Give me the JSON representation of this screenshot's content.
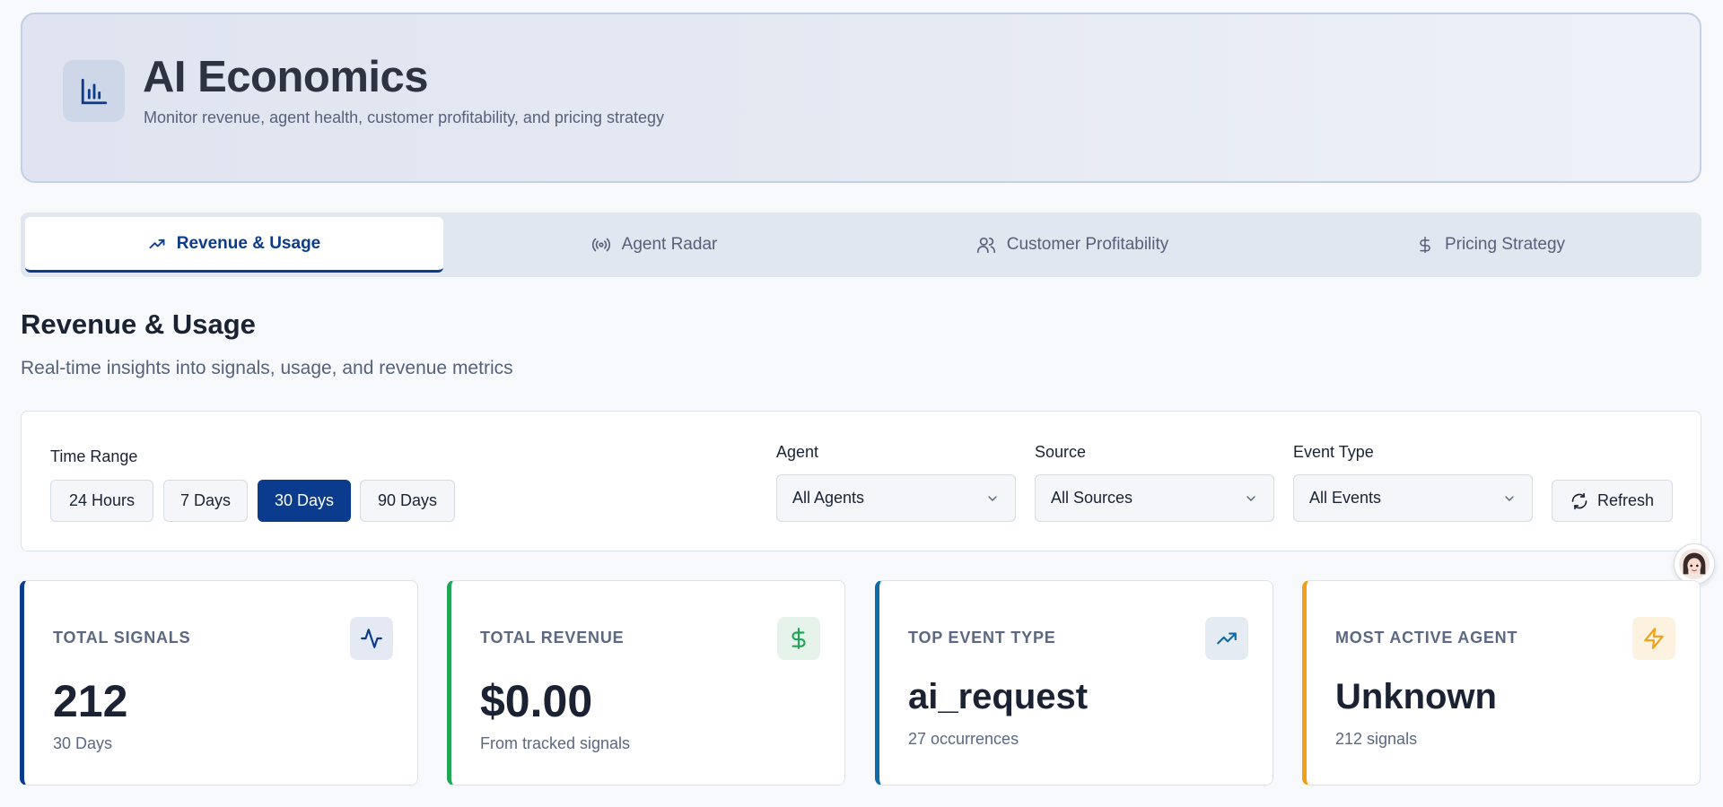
{
  "header": {
    "title": "AI Economics",
    "subtitle": "Monitor revenue, agent health, customer profitability, and pricing strategy",
    "icon": "bar-chart-icon"
  },
  "tabs": [
    {
      "label": "Revenue & Usage",
      "icon": "trending-up-icon",
      "active": true
    },
    {
      "label": "Agent Radar",
      "icon": "radio-icon",
      "active": false
    },
    {
      "label": "Customer Profitability",
      "icon": "users-icon",
      "active": false
    },
    {
      "label": "Pricing Strategy",
      "icon": "dollar-icon",
      "active": false
    }
  ],
  "section": {
    "title": "Revenue & Usage",
    "subtitle": "Real-time insights into signals, usage, and revenue metrics"
  },
  "filters": {
    "time_range_label": "Time Range",
    "ranges": [
      "24 Hours",
      "7 Days",
      "30 Days",
      "90 Days"
    ],
    "selected_range": "30 Days",
    "agent_label": "Agent",
    "agent_value": "All Agents",
    "source_label": "Source",
    "source_value": "All Sources",
    "event_type_label": "Event Type",
    "event_type_value": "All Events",
    "refresh_label": "Refresh"
  },
  "cards": [
    {
      "label": "TOTAL SIGNALS",
      "value": "212",
      "sub": "30 Days",
      "accent": "#0b3b8c",
      "icon": "activity-icon"
    },
    {
      "label": "TOTAL REVENUE",
      "value": "$0.00",
      "sub": "From tracked signals",
      "accent": "#22a559",
      "icon": "dollar-icon"
    },
    {
      "label": "TOP EVENT TYPE",
      "value": "ai_request",
      "sub": "27 occurrences",
      "accent": "#0f6aa8",
      "icon": "trending-up-icon"
    },
    {
      "label": "MOST ACTIVE AGENT",
      "value": "Unknown",
      "sub": "212 signals",
      "accent": "#f0a019",
      "icon": "zap-icon"
    }
  ],
  "colors": {
    "primary": "#0b3b8c",
    "background": "#f7f9fc",
    "green": "#22a559",
    "teal": "#0f6aa8",
    "amber": "#f0a019"
  }
}
